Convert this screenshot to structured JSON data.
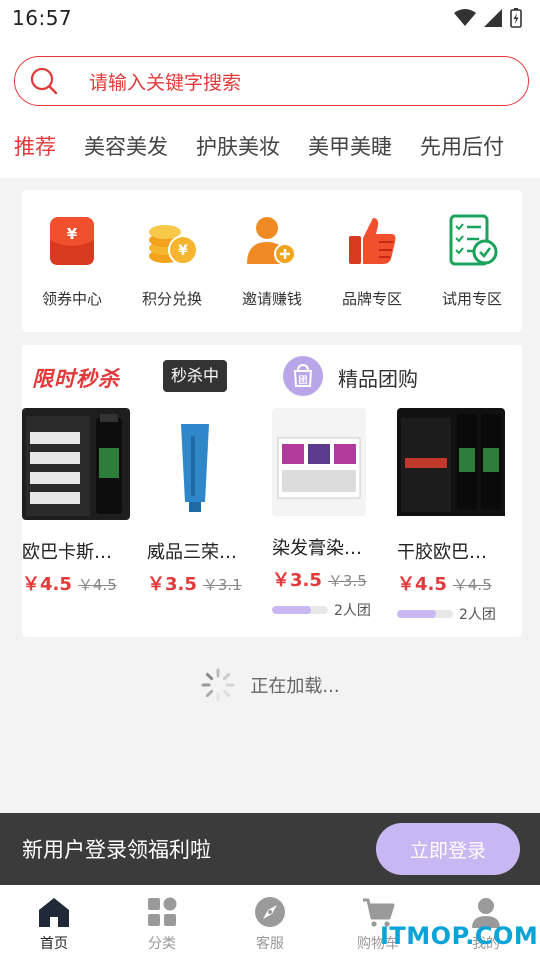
{
  "status_bar": {
    "time": "16:57"
  },
  "search": {
    "placeholder": "请输入关键字搜索"
  },
  "tabs": [
    {
      "label": "推荐",
      "active": true
    },
    {
      "label": "美容美发"
    },
    {
      "label": "护肤美妆"
    },
    {
      "label": "美甲美睫"
    },
    {
      "label": "先用后付"
    }
  ],
  "quick_entries": [
    {
      "label": "领券中心",
      "icon": "coupon-icon"
    },
    {
      "label": "积分兑换",
      "icon": "coins-icon"
    },
    {
      "label": "邀请赚钱",
      "icon": "invite-user-icon"
    },
    {
      "label": "品牌专区",
      "icon": "thumbs-up-icon"
    },
    {
      "label": "试用专区",
      "icon": "trial-checklist-icon"
    }
  ],
  "flash_sale": {
    "title": "限时秒杀",
    "badge": "秒杀中",
    "products": [
      {
        "name": "欧巴卡斯…",
        "price": "￥4.5",
        "old_price": "￥4.5",
        "image": "hairspray-bottle"
      },
      {
        "name": "威品三荣…",
        "price": "￥3.5",
        "old_price": "￥3.1",
        "image": "blue-tube"
      }
    ]
  },
  "group_buy": {
    "title": "精品团购",
    "products": [
      {
        "name": "染发膏染…",
        "price": "￥3.5",
        "old_price": "￥3.5",
        "group_label": "2人团",
        "group_progress": 0.7,
        "image": "hair-dye-boxes"
      },
      {
        "name": "干胶欧巴…",
        "price": "￥4.5",
        "old_price": "￥4.5",
        "group_label": "2人团",
        "group_progress": 0.7,
        "image": "spray-cans"
      }
    ]
  },
  "loading": {
    "text": "正在加载..."
  },
  "login_prompt": {
    "text": "新用户登录领福利啦",
    "button": "立即登录"
  },
  "bottom_nav": [
    {
      "label": "首页",
      "icon": "home-icon",
      "active": true
    },
    {
      "label": "分类",
      "icon": "category-grid-icon"
    },
    {
      "label": "客服",
      "icon": "compass-icon"
    },
    {
      "label": "购物车",
      "icon": "cart-icon"
    },
    {
      "label": "我的",
      "icon": "user-icon"
    }
  ],
  "watermark": "ITMOP.COM",
  "colors": {
    "accent": "#e23a3a",
    "lavender": "#c9b7f3",
    "dark_bar": "#3b3b3b"
  }
}
